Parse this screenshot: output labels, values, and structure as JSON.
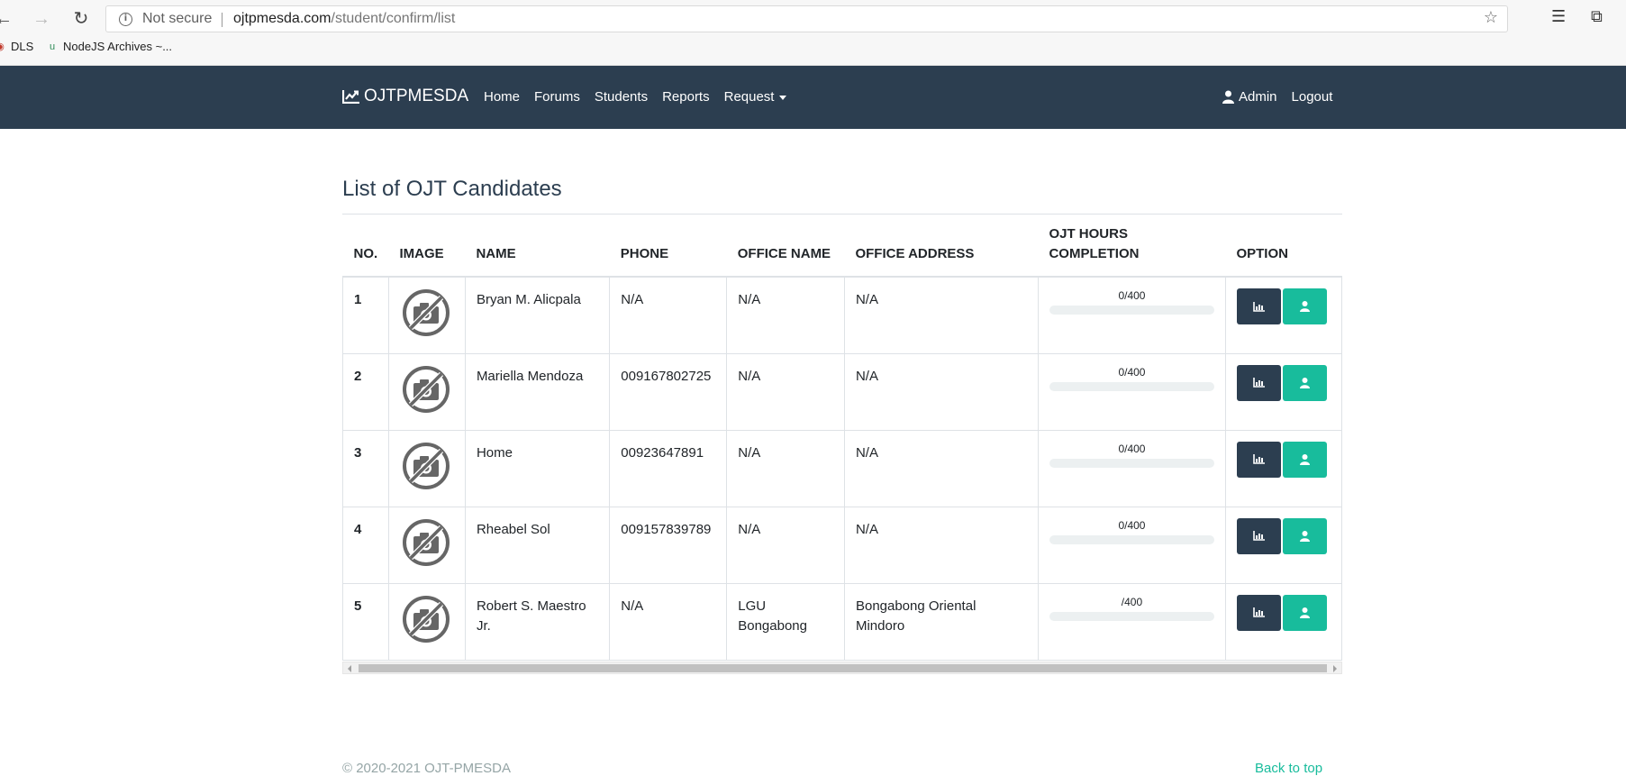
{
  "browser": {
    "security_label": "Not secure",
    "url_host": "ojtpmesda.com",
    "url_path": "/student/confirm/list",
    "bookmarks": [
      {
        "label": "DLS"
      },
      {
        "label": "NodeJS Archives ~..."
      }
    ]
  },
  "navbar": {
    "brand": "OJTPMESDA",
    "links": [
      "Home",
      "Forums",
      "Students",
      "Reports",
      "Request"
    ],
    "admin_label": "Admin",
    "logout_label": "Logout"
  },
  "page": {
    "title": "List of OJT Candidates"
  },
  "table": {
    "headers": {
      "no": "NO.",
      "image": "IMAGE",
      "name": "NAME",
      "phone": "PHONE",
      "office_name": "OFFICE NAME",
      "office_address": "OFFICE ADDRESS",
      "hours_line1": "OJT HOURS",
      "hours_line2": "COMPLETION",
      "option": "OPTION"
    },
    "rows": [
      {
        "no": "1",
        "name": "Bryan M. Alicpala",
        "phone": "N/A",
        "office_name": "N/A",
        "office_address": "N/A",
        "hours": "0/400",
        "progress": 0
      },
      {
        "no": "2",
        "name": "Mariella Mendoza",
        "phone": "009167802725",
        "office_name": "N/A",
        "office_address": "N/A",
        "hours": "0/400",
        "progress": 0
      },
      {
        "no": "3",
        "name": "Home",
        "phone": "00923647891",
        "office_name": "N/A",
        "office_address": "N/A",
        "hours": "0/400",
        "progress": 0
      },
      {
        "no": "4",
        "name": "Rheabel Sol",
        "phone": "009157839789",
        "office_name": "N/A",
        "office_address": "N/A",
        "hours": "0/400",
        "progress": 0
      },
      {
        "no": "5",
        "name": "Robert S. Maestro Jr.",
        "phone": "N/A",
        "office_name": "LGU Bongabong",
        "office_address": "Bongabong Oriental Mindoro",
        "hours": "/400",
        "progress": 0
      }
    ]
  },
  "footer": {
    "copyright": "© 2020-2021 OJT-PMESDA",
    "back_to_top": "Back to top"
  },
  "colors": {
    "navbar": "#2c3e50",
    "accent": "#18bc9c",
    "muted": "#95a5a6"
  }
}
